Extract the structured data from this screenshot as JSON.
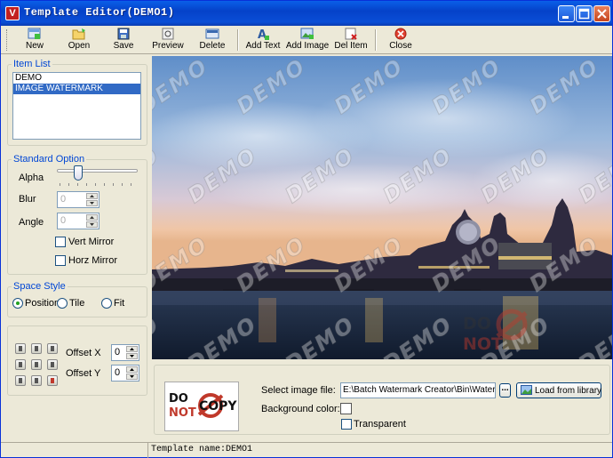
{
  "window": {
    "title": "Template Editor(DEMO1)",
    "icon": "app-logo-icon"
  },
  "toolbar": {
    "buttons": [
      {
        "label": "New",
        "icon": "new-doc-icon"
      },
      {
        "label": "Open",
        "icon": "folder-open-icon"
      },
      {
        "label": "Save",
        "icon": "floppy-icon"
      },
      {
        "label": "Preview",
        "icon": "preview-icon"
      },
      {
        "label": "Delete",
        "icon": "delete-icon"
      },
      {
        "label": "Add Text",
        "icon": "add-text-icon"
      },
      {
        "label": "Add Image",
        "icon": "add-image-icon"
      },
      {
        "label": "Del Item",
        "icon": "del-item-icon"
      },
      {
        "label": "Close",
        "icon": "close-red-icon"
      }
    ]
  },
  "item_list": {
    "title": "Item List",
    "items": [
      "DEMO",
      "IMAGE WATERMARK"
    ],
    "selected": "IMAGE WATERMARK"
  },
  "standard_option": {
    "title": "Standard Option",
    "alpha_label": "Alpha",
    "blur_label": "Blur",
    "blur_value": "0",
    "angle_label": "Angle",
    "angle_value": "0",
    "vert_mirror": "Vert Mirror",
    "vert_mirror_checked": false,
    "horz_mirror": "Horz Mirror",
    "horz_mirror_checked": false
  },
  "space_style": {
    "title": "Space Style",
    "position": "Position",
    "tile": "Tile",
    "fit": "Fit",
    "selected": "Position"
  },
  "offset": {
    "x_label": "Offset X",
    "x_value": "0",
    "y_label": "Offset Y",
    "y_value": "0"
  },
  "preview": {
    "watermark_text": "DEMO"
  },
  "image_panel": {
    "thumb_text": {
      "do": "DO",
      "not": "NOT",
      "copy": "COPY"
    },
    "select_label": "Select image file:",
    "file_path": "E:\\Batch Watermark Creator\\Bin\\Watermar",
    "browse": "...",
    "load_button": "Load from library",
    "bg_color_label": "Background color:",
    "transparent_label": "Transparent",
    "transparent_checked": false
  },
  "status": {
    "text": "Template name:DEMO1"
  },
  "colors": {
    "accent": "#0046d5",
    "titlebar": "#0a4ed6",
    "selection": "#316ac5"
  }
}
